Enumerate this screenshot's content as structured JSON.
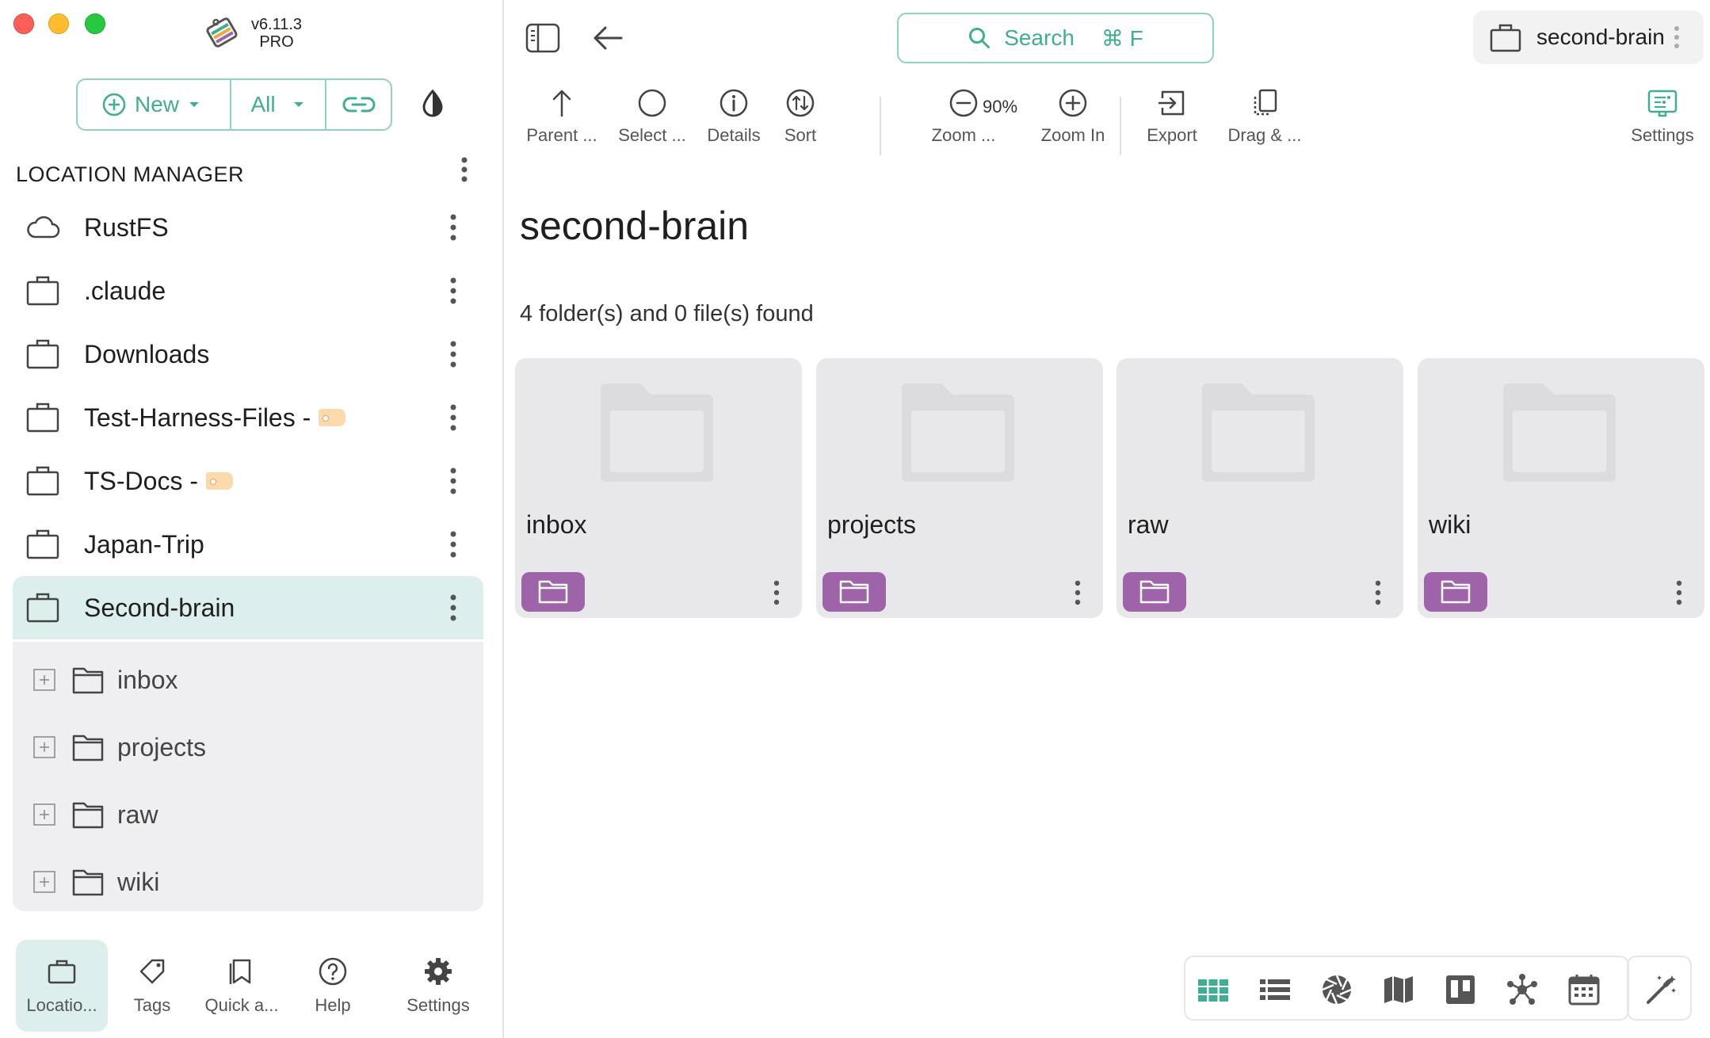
{
  "app": {
    "version": "v6.11.3",
    "edition": "PRO"
  },
  "sidebar": {
    "new_label": "New",
    "filter_label": "All",
    "section_title": "LOCATION MANAGER",
    "locations": [
      {
        "label": "RustFS",
        "icon": "cloud-icon"
      },
      {
        "label": ".claude",
        "icon": "briefcase-icon"
      },
      {
        "label": "Downloads",
        "icon": "briefcase-icon"
      },
      {
        "label": "Test-Harness-Files -",
        "icon": "briefcase-icon",
        "tagged": true
      },
      {
        "label": "TS-Docs -",
        "icon": "briefcase-icon",
        "tagged": true
      },
      {
        "label": "Japan-Trip",
        "icon": "briefcase-icon"
      },
      {
        "label": "Second-brain",
        "icon": "briefcase-icon",
        "selected": true
      }
    ],
    "tree": [
      {
        "label": "inbox"
      },
      {
        "label": "projects"
      },
      {
        "label": "raw"
      },
      {
        "label": "wiki"
      }
    ],
    "bottom_nav": [
      {
        "label": "Locatio...",
        "icon": "briefcase-icon",
        "active": true
      },
      {
        "label": "Tags",
        "icon": "tag-icon"
      },
      {
        "label": "Quick a...",
        "icon": "bookmark-icon"
      },
      {
        "label": "Help",
        "icon": "help-icon"
      },
      {
        "label": "Settings",
        "icon": "gear-icon"
      }
    ]
  },
  "header": {
    "search_label": "Search",
    "search_shortcut": "⌘ F",
    "location_name": "second-brain"
  },
  "toolbar": {
    "parent": "Parent ...",
    "select": "Select ...",
    "details": "Details",
    "sort": "Sort",
    "zoom_out": "Zoom ...",
    "zoom_level": "90%",
    "zoom_in": "Zoom In",
    "export": "Export",
    "drag": "Drag & ...",
    "settings": "Settings"
  },
  "content": {
    "title": "second-brain",
    "count_text": "4 folder(s) and 0 file(s) found",
    "folders": [
      {
        "name": "inbox"
      },
      {
        "name": "projects"
      },
      {
        "name": "raw"
      },
      {
        "name": "wiki"
      }
    ]
  },
  "view_modes": [
    "grid-view-icon",
    "list-view-icon",
    "gallery-view-icon",
    "map-view-icon",
    "kanban-view-icon",
    "graph-view-icon",
    "calendar-view-icon"
  ],
  "colors": {
    "accent": "#3fae92",
    "accent_border": "#8fd4c2",
    "selected_bg": "#dcefec",
    "folder_badge": "#9e63a8",
    "card_bg": "#e8e7ea",
    "tag_chip": "#fad9ad"
  }
}
